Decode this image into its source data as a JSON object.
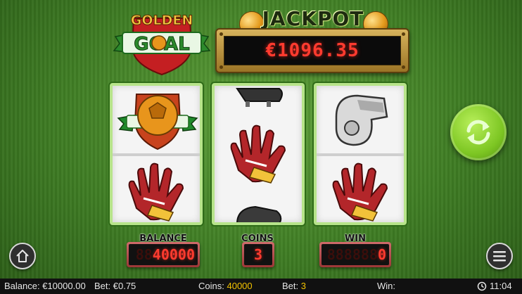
{
  "logo": {
    "line1": "GOLDEN",
    "line2": "GOAL"
  },
  "jackpot": {
    "title": "JACKPOT",
    "value": "€1096.35"
  },
  "reels": [
    {
      "top": "shield-ball",
      "middle": "goalkeeper-glove-icon",
      "id": "reel-1"
    },
    {
      "top": "soccer-boot",
      "middle": "goalkeeper-glove-icon",
      "bottom": "soccer-boot",
      "id": "reel-2"
    },
    {
      "top": "whistle",
      "middle": "goalkeeper-glove-icon",
      "id": "reel-3"
    }
  ],
  "counters": {
    "balance": {
      "label": "BALANCE",
      "ghost": "88",
      "value": "40000"
    },
    "coins": {
      "label": "COINS",
      "value": "3"
    },
    "win": {
      "label": "WIN",
      "ghost": "888888",
      "value": "0"
    }
  },
  "status_bar": {
    "balance_label": "Balance:",
    "balance_value": "€10000.00",
    "bet_label": "Bet:",
    "bet_value": "€0.75",
    "coins_label": "Coins:",
    "coins_value": "40000",
    "bet2_label": "Bet:",
    "bet2_value": "3",
    "win_label": "Win:",
    "win_value": "",
    "time": "11:04"
  },
  "colors": {
    "accent_green": "#7dc623",
    "led_red": "#ff3b2f",
    "status_yellow": "#f2c200"
  }
}
